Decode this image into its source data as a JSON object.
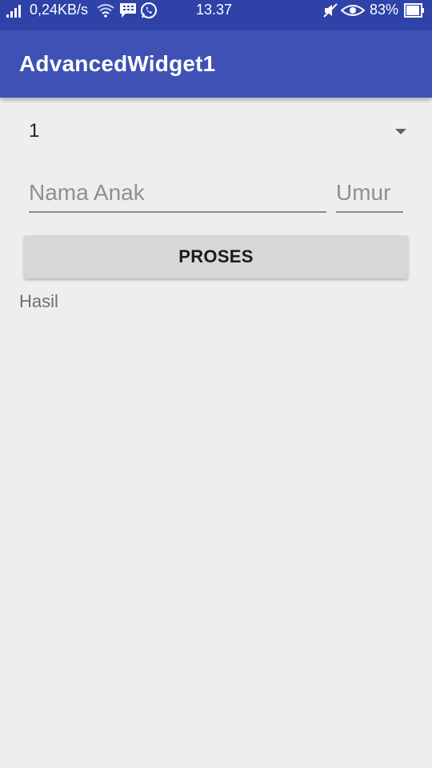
{
  "status_bar": {
    "network_speed": "0,24KB/s",
    "time": "13.37",
    "battery": "83%",
    "icons": [
      "signal-icon",
      "wifi-icon",
      "bbm-icon",
      "whatsapp-icon",
      "mute-icon",
      "eye-icon",
      "battery-icon"
    ]
  },
  "app_bar": {
    "title": "AdvancedWidget1"
  },
  "spinner": {
    "selected_value": "1"
  },
  "form": {
    "nama_placeholder": "Nama Anak",
    "umur_placeholder": "Umur",
    "nama_value": "",
    "umur_value": ""
  },
  "actions": {
    "proses_label": "PROSES"
  },
  "result": {
    "text": "Hasil"
  },
  "colors": {
    "status_bar": "#2f42a8",
    "app_bar": "#3f51b5",
    "background": "#eeeeee",
    "button": "#d6d7d7"
  }
}
